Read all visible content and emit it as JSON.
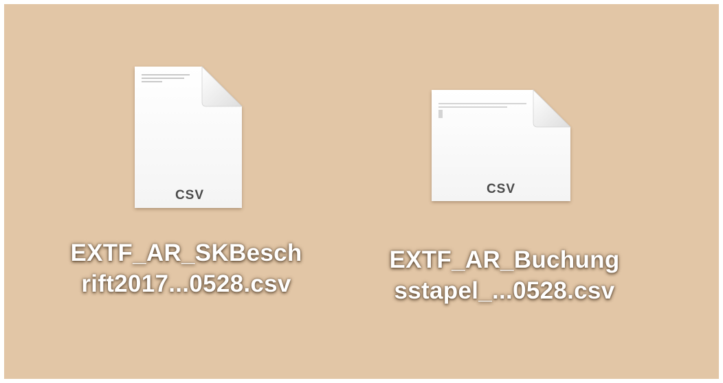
{
  "desktop": {
    "background_color": "#e2c6a6",
    "files": [
      {
        "icon": "csv-document-icon",
        "extension_badge": "CSV",
        "name_line1": "EXTF_AR_SKBesch",
        "name_line2": "rift2017...0528.csv"
      },
      {
        "icon": "csv-document-icon",
        "extension_badge": "CSV",
        "name_line1": "EXTF_AR_Buchung",
        "name_line2": "sstapel_...0528.csv"
      }
    ]
  }
}
